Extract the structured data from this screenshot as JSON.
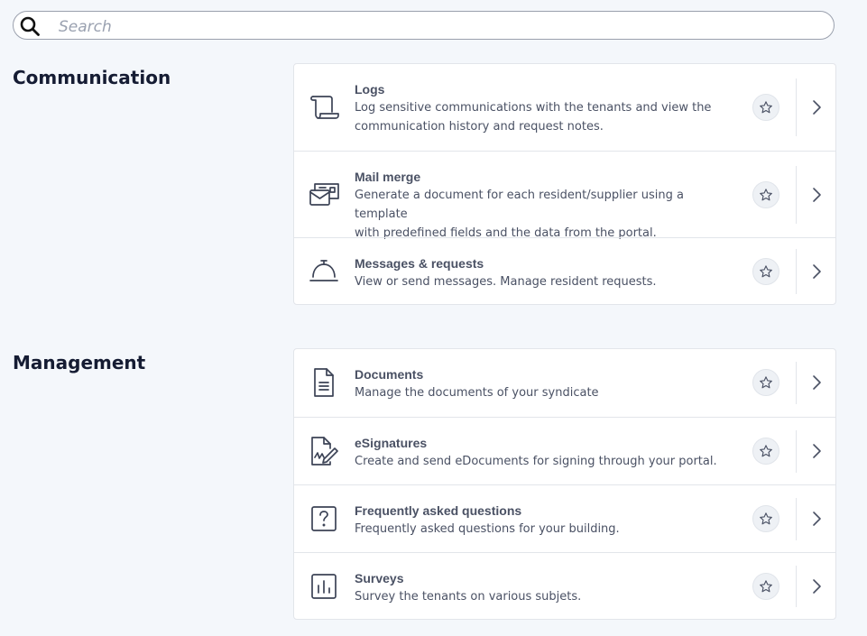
{
  "search": {
    "placeholder": "Search",
    "icon": "search-icon"
  },
  "sections": [
    {
      "title": "Communication",
      "items": [
        {
          "title": "Logs",
          "desc1": "Log sensitive communications with the tenants and view the",
          "desc2": "communication history and request notes.",
          "icon": "scroll-icon"
        },
        {
          "title": "Mail merge",
          "desc1": "Generate a document for each resident/supplier using a template",
          "desc2": "with predefined fields and the data from the portal.",
          "icon": "mail-merge-icon"
        },
        {
          "title": "Messages & requests",
          "desc1": "View or send messages. Manage resident requests.",
          "icon": "service-bell-icon"
        }
      ]
    },
    {
      "title": "Management",
      "items": [
        {
          "title": "Documents",
          "desc1": "Manage the documents of your syndicate",
          "icon": "document-icon"
        },
        {
          "title": "eSignatures",
          "desc1": "Create and send eDocuments for signing through your portal.",
          "icon": "signature-icon"
        },
        {
          "title": "Frequently asked questions",
          "desc1": "Frequently asked questions for your building.",
          "icon": "question-icon"
        },
        {
          "title": "Surveys",
          "desc1": "Survey the tenants on various subjets.",
          "icon": "chart-icon"
        }
      ]
    }
  ],
  "colors": {
    "icon": "#3c4356",
    "text": "#4a5164",
    "heading": "#151c33",
    "background": "#f4f7fb"
  }
}
